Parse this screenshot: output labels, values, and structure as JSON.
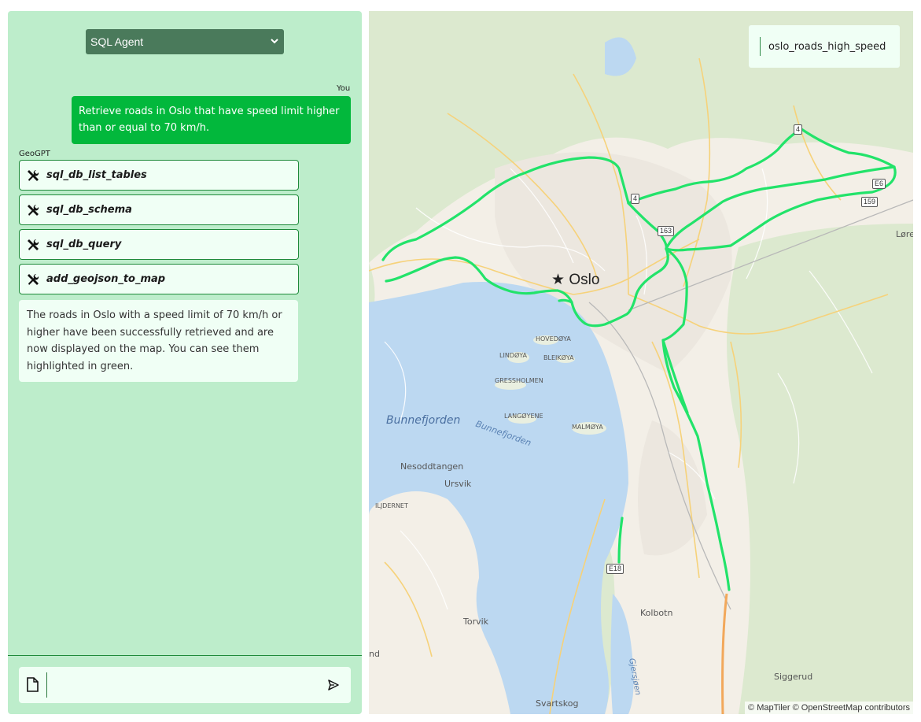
{
  "chat": {
    "agent_select": "SQL Agent",
    "user_label": "You",
    "user_message": "Retrieve roads in Oslo that have speed limit higher than or equal to 70 km/h.",
    "bot_label": "GeoGPT",
    "tool_calls": [
      {
        "name": "sql_db_list_tables",
        "icon": "tools-icon"
      },
      {
        "name": "sql_db_schema",
        "icon": "tools-icon"
      },
      {
        "name": "sql_db_query",
        "icon": "tools-icon"
      },
      {
        "name": "add_geojson_to_map",
        "icon": "tools-icon"
      }
    ],
    "ai_message": "The roads in Oslo with a speed limit of 70 km/h or higher have been successfully retrieved and are now displayed on the map. You can see them highlighted in green.",
    "input_placeholder": "",
    "attach_icon": "file-icon",
    "send_icon": "send-icon"
  },
  "map": {
    "layer_name": "oslo_roads_high_speed",
    "highlight_color": "#22e36a",
    "attribution": "© MapTiler © OpenStreetMap contributors",
    "city_label": "Oslo",
    "place_labels": [
      "Bunnefjorden",
      "Bunnefjorden",
      "Nesoddtangen",
      "Ursvik",
      "ILJDERNET",
      "Torvik",
      "Kolbotn",
      "Siggerud",
      "Svartskog",
      "Gjersjøen",
      "Løre",
      "nd"
    ],
    "island_labels": [
      "HOVEDØYA",
      "LINDØYA",
      "BLEIKØYA",
      "GRESSHOLMEN",
      "LANGØYENE",
      "MALMØYA"
    ],
    "road_shields": [
      "4",
      "4",
      "163",
      "E6",
      "159",
      "E18"
    ]
  }
}
